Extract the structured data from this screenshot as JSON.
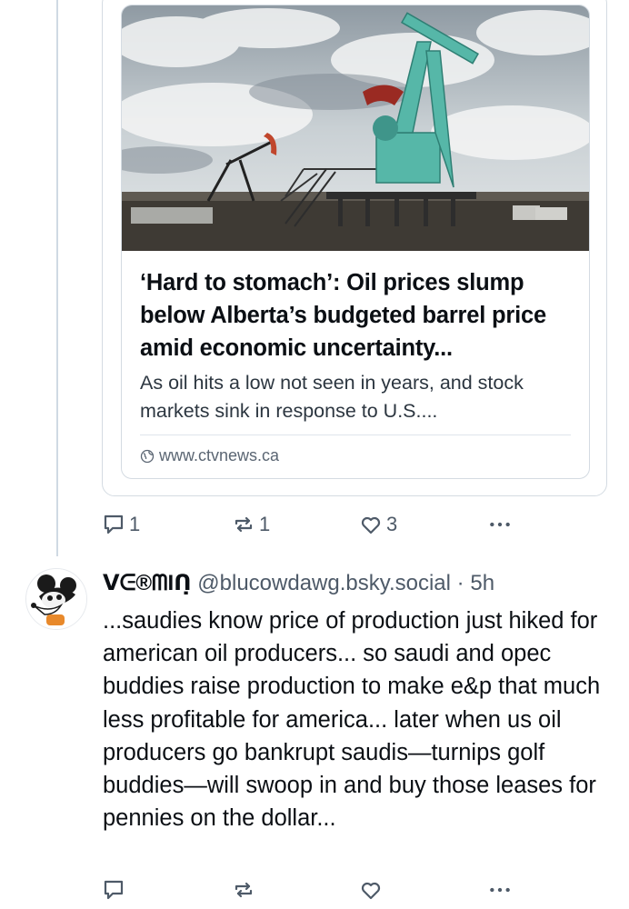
{
  "embed": {
    "title": "‘Hard to stomach’: Oil prices slump below Alberta’s budgeted barrel price amid economic uncertainty...",
    "description": "As oil hits a low not seen in years, and stock markets sink in response to U.S....",
    "domain": "www.ctvnews.ca"
  },
  "first_post_actions": {
    "reply_count": "1",
    "repost_count": "1",
    "like_count": "3"
  },
  "reply_post": {
    "display_name": "ᐯᕮ®ᗰIᑎ̣",
    "handle": "@blucowdawg.bsky.social",
    "separator": "·",
    "time": "5h",
    "text": "...saudies know price of production just hiked for american oil producers... so saudi and opec buddies raise production to make e&p that much less profitable for america... later when us oil producers go bankrupt saudis—turnips golf buddies—will swoop in and buy those leases for pennies on the dollar..."
  },
  "colors": {
    "accent_icon": "#4e5a68",
    "border": "#d4dbe2",
    "text": "#0b0f14"
  }
}
